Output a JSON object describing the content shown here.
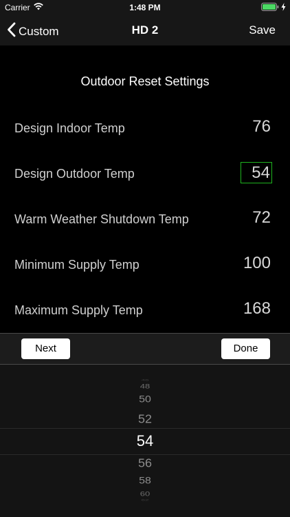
{
  "status_bar": {
    "carrier": "Carrier",
    "time": "1:48 PM"
  },
  "nav": {
    "back_label": "Custom",
    "title": "HD 2",
    "save_label": "Save"
  },
  "section_title": "Outdoor Reset Settings",
  "settings": [
    {
      "label": "Design Indoor Temp",
      "value": "76"
    },
    {
      "label": "Design Outdoor Temp",
      "value": "54"
    },
    {
      "label": "Warm Weather Shutdown Temp",
      "value": "72"
    },
    {
      "label": "Minimum Supply Temp",
      "value": "100"
    },
    {
      "label": "Maximum Supply Temp",
      "value": "168"
    }
  ],
  "active_setting_index": 1,
  "toolbar": {
    "next_label": "Next",
    "done_label": "Done"
  },
  "picker": {
    "items": [
      "46",
      "48",
      "50",
      "52",
      "54",
      "56",
      "58",
      "60",
      "62"
    ],
    "selected": "54"
  },
  "colors": {
    "active_border": "#1fb51f",
    "background": "#000000",
    "bar": "#171717",
    "battery": "#4cd964"
  },
  "icons": {
    "wifi": "wifi-icon",
    "back": "chevron-left-icon",
    "battery": "battery-icon",
    "charging": "bolt-icon"
  }
}
